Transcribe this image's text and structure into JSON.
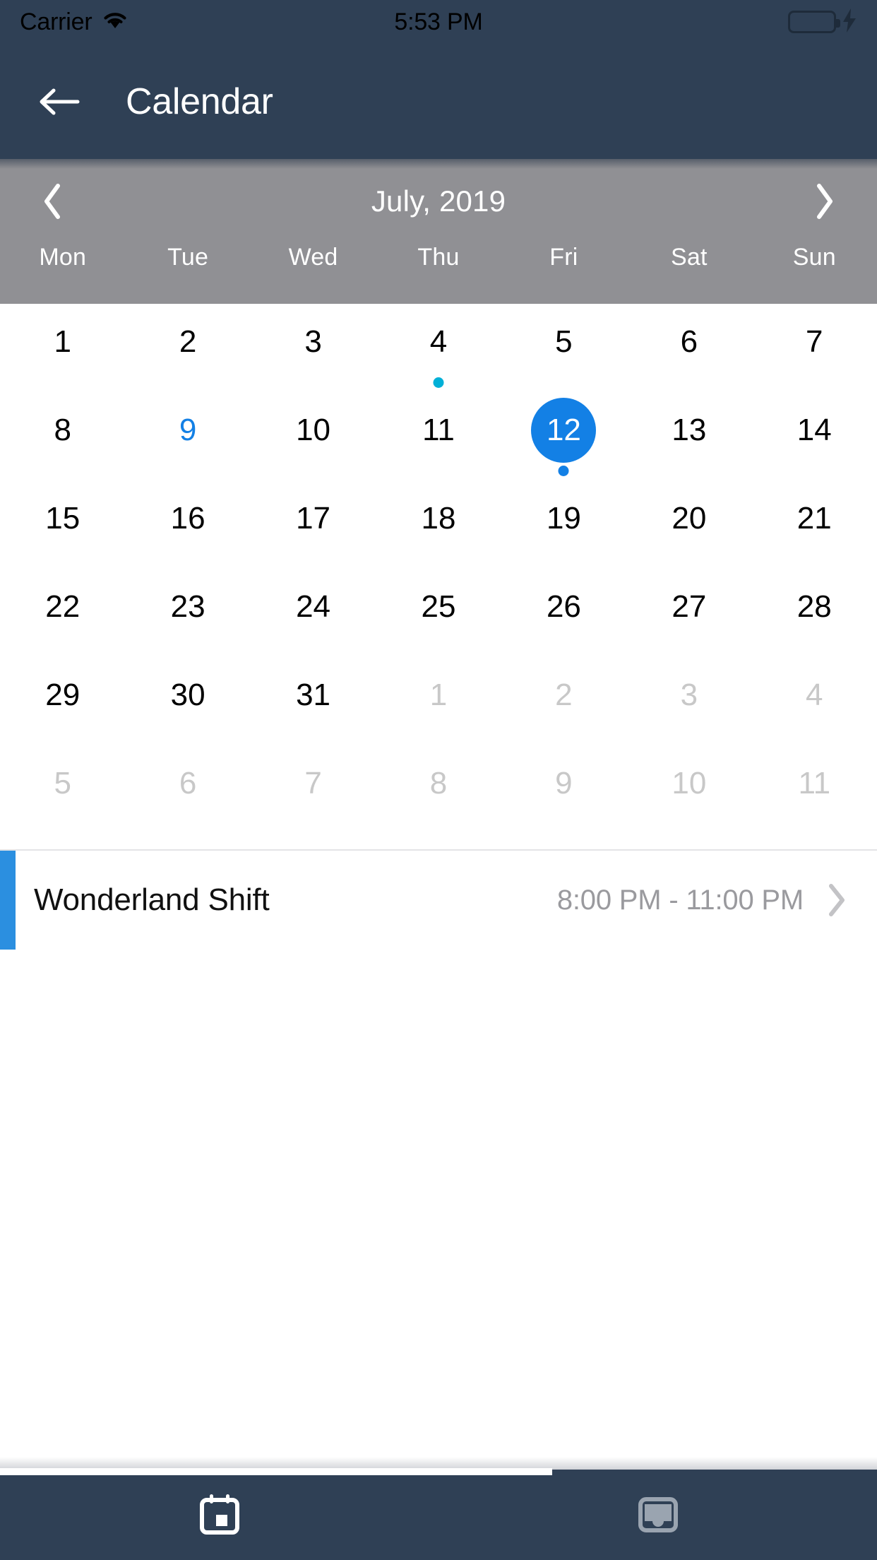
{
  "status_bar": {
    "carrier": "Carrier",
    "time": "5:53 PM",
    "wifi_icon": "wifi-icon",
    "battery_icon": "battery-full-icon",
    "charging_icon": "lightning-bolt-icon",
    "battery_color": "#4cd964"
  },
  "header": {
    "back_icon": "arrow-left-icon",
    "title": "Calendar",
    "background_color": "#2f4055"
  },
  "month_bar": {
    "prev_icon": "chevron-left-icon",
    "next_icon": "chevron-right-icon",
    "month_label": "July, 2019",
    "background_color": "#909094",
    "weekdays": [
      "Mon",
      "Tue",
      "Wed",
      "Thu",
      "Fri",
      "Sat",
      "Sun"
    ]
  },
  "calendar": {
    "accent_color": "#1380e5",
    "event_dot_color": "#00b0d7",
    "selected_dot_color": "#1380e5",
    "muted_color": "#c8c8c8",
    "days": [
      {
        "n": "1",
        "state": "normal",
        "dot": null
      },
      {
        "n": "2",
        "state": "normal",
        "dot": null
      },
      {
        "n": "3",
        "state": "normal",
        "dot": null
      },
      {
        "n": "4",
        "state": "normal",
        "dot": "#00b0d7"
      },
      {
        "n": "5",
        "state": "normal",
        "dot": null
      },
      {
        "n": "6",
        "state": "normal",
        "dot": null
      },
      {
        "n": "7",
        "state": "normal",
        "dot": null
      },
      {
        "n": "8",
        "state": "normal",
        "dot": null
      },
      {
        "n": "9",
        "state": "today",
        "dot": null
      },
      {
        "n": "10",
        "state": "normal",
        "dot": null
      },
      {
        "n": "11",
        "state": "normal",
        "dot": null
      },
      {
        "n": "12",
        "state": "selected",
        "dot": "#1380e5"
      },
      {
        "n": "13",
        "state": "normal",
        "dot": null
      },
      {
        "n": "14",
        "state": "normal",
        "dot": null
      },
      {
        "n": "15",
        "state": "normal",
        "dot": null
      },
      {
        "n": "16",
        "state": "normal",
        "dot": null
      },
      {
        "n": "17",
        "state": "normal",
        "dot": null
      },
      {
        "n": "18",
        "state": "normal",
        "dot": null
      },
      {
        "n": "19",
        "state": "normal",
        "dot": null
      },
      {
        "n": "20",
        "state": "normal",
        "dot": null
      },
      {
        "n": "21",
        "state": "normal",
        "dot": null
      },
      {
        "n": "22",
        "state": "normal",
        "dot": null
      },
      {
        "n": "23",
        "state": "normal",
        "dot": null
      },
      {
        "n": "24",
        "state": "normal",
        "dot": null
      },
      {
        "n": "25",
        "state": "normal",
        "dot": null
      },
      {
        "n": "26",
        "state": "normal",
        "dot": null
      },
      {
        "n": "27",
        "state": "normal",
        "dot": null
      },
      {
        "n": "28",
        "state": "normal",
        "dot": null
      },
      {
        "n": "29",
        "state": "normal",
        "dot": null
      },
      {
        "n": "30",
        "state": "normal",
        "dot": null
      },
      {
        "n": "31",
        "state": "normal",
        "dot": null
      },
      {
        "n": "1",
        "state": "muted",
        "dot": null
      },
      {
        "n": "2",
        "state": "muted",
        "dot": null
      },
      {
        "n": "3",
        "state": "muted",
        "dot": null
      },
      {
        "n": "4",
        "state": "muted",
        "dot": null
      },
      {
        "n": "5",
        "state": "muted",
        "dot": null
      },
      {
        "n": "6",
        "state": "muted",
        "dot": null
      },
      {
        "n": "7",
        "state": "muted",
        "dot": null
      },
      {
        "n": "8",
        "state": "muted",
        "dot": null
      },
      {
        "n": "9",
        "state": "muted",
        "dot": null
      },
      {
        "n": "10",
        "state": "muted",
        "dot": null
      },
      {
        "n": "11",
        "state": "muted",
        "dot": null
      }
    ]
  },
  "events": [
    {
      "title": "Wonderland Shift",
      "time": "8:00 PM - 11:00 PM",
      "accent_color": "#2b8fe0",
      "chevron_icon": "chevron-right-icon"
    }
  ],
  "tab_bar": {
    "background_color": "#2f4055",
    "items": [
      {
        "icon": "calendar-icon",
        "active": true
      },
      {
        "icon": "inbox-icon",
        "active": false
      }
    ]
  }
}
